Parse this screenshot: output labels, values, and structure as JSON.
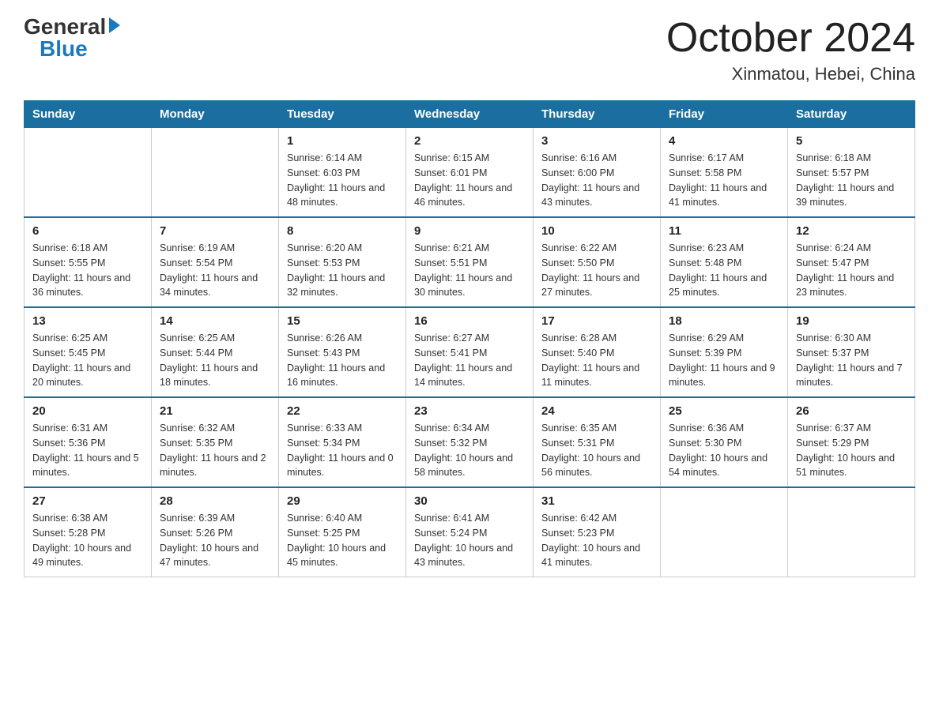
{
  "logo": {
    "general": "General",
    "blue": "Blue",
    "triangle": "▶"
  },
  "title": "October 2024",
  "location": "Xinmatou, Hebei, China",
  "headers": [
    "Sunday",
    "Monday",
    "Tuesday",
    "Wednesday",
    "Thursday",
    "Friday",
    "Saturday"
  ],
  "weeks": [
    [
      {
        "day": "",
        "sunrise": "",
        "sunset": "",
        "daylight": ""
      },
      {
        "day": "",
        "sunrise": "",
        "sunset": "",
        "daylight": ""
      },
      {
        "day": "1",
        "sunrise": "Sunrise: 6:14 AM",
        "sunset": "Sunset: 6:03 PM",
        "daylight": "Daylight: 11 hours and 48 minutes."
      },
      {
        "day": "2",
        "sunrise": "Sunrise: 6:15 AM",
        "sunset": "Sunset: 6:01 PM",
        "daylight": "Daylight: 11 hours and 46 minutes."
      },
      {
        "day": "3",
        "sunrise": "Sunrise: 6:16 AM",
        "sunset": "Sunset: 6:00 PM",
        "daylight": "Daylight: 11 hours and 43 minutes."
      },
      {
        "day": "4",
        "sunrise": "Sunrise: 6:17 AM",
        "sunset": "Sunset: 5:58 PM",
        "daylight": "Daylight: 11 hours and 41 minutes."
      },
      {
        "day": "5",
        "sunrise": "Sunrise: 6:18 AM",
        "sunset": "Sunset: 5:57 PM",
        "daylight": "Daylight: 11 hours and 39 minutes."
      }
    ],
    [
      {
        "day": "6",
        "sunrise": "Sunrise: 6:18 AM",
        "sunset": "Sunset: 5:55 PM",
        "daylight": "Daylight: 11 hours and 36 minutes."
      },
      {
        "day": "7",
        "sunrise": "Sunrise: 6:19 AM",
        "sunset": "Sunset: 5:54 PM",
        "daylight": "Daylight: 11 hours and 34 minutes."
      },
      {
        "day": "8",
        "sunrise": "Sunrise: 6:20 AM",
        "sunset": "Sunset: 5:53 PM",
        "daylight": "Daylight: 11 hours and 32 minutes."
      },
      {
        "day": "9",
        "sunrise": "Sunrise: 6:21 AM",
        "sunset": "Sunset: 5:51 PM",
        "daylight": "Daylight: 11 hours and 30 minutes."
      },
      {
        "day": "10",
        "sunrise": "Sunrise: 6:22 AM",
        "sunset": "Sunset: 5:50 PM",
        "daylight": "Daylight: 11 hours and 27 minutes."
      },
      {
        "day": "11",
        "sunrise": "Sunrise: 6:23 AM",
        "sunset": "Sunset: 5:48 PM",
        "daylight": "Daylight: 11 hours and 25 minutes."
      },
      {
        "day": "12",
        "sunrise": "Sunrise: 6:24 AM",
        "sunset": "Sunset: 5:47 PM",
        "daylight": "Daylight: 11 hours and 23 minutes."
      }
    ],
    [
      {
        "day": "13",
        "sunrise": "Sunrise: 6:25 AM",
        "sunset": "Sunset: 5:45 PM",
        "daylight": "Daylight: 11 hours and 20 minutes."
      },
      {
        "day": "14",
        "sunrise": "Sunrise: 6:25 AM",
        "sunset": "Sunset: 5:44 PM",
        "daylight": "Daylight: 11 hours and 18 minutes."
      },
      {
        "day": "15",
        "sunrise": "Sunrise: 6:26 AM",
        "sunset": "Sunset: 5:43 PM",
        "daylight": "Daylight: 11 hours and 16 minutes."
      },
      {
        "day": "16",
        "sunrise": "Sunrise: 6:27 AM",
        "sunset": "Sunset: 5:41 PM",
        "daylight": "Daylight: 11 hours and 14 minutes."
      },
      {
        "day": "17",
        "sunrise": "Sunrise: 6:28 AM",
        "sunset": "Sunset: 5:40 PM",
        "daylight": "Daylight: 11 hours and 11 minutes."
      },
      {
        "day": "18",
        "sunrise": "Sunrise: 6:29 AM",
        "sunset": "Sunset: 5:39 PM",
        "daylight": "Daylight: 11 hours and 9 minutes."
      },
      {
        "day": "19",
        "sunrise": "Sunrise: 6:30 AM",
        "sunset": "Sunset: 5:37 PM",
        "daylight": "Daylight: 11 hours and 7 minutes."
      }
    ],
    [
      {
        "day": "20",
        "sunrise": "Sunrise: 6:31 AM",
        "sunset": "Sunset: 5:36 PM",
        "daylight": "Daylight: 11 hours and 5 minutes."
      },
      {
        "day": "21",
        "sunrise": "Sunrise: 6:32 AM",
        "sunset": "Sunset: 5:35 PM",
        "daylight": "Daylight: 11 hours and 2 minutes."
      },
      {
        "day": "22",
        "sunrise": "Sunrise: 6:33 AM",
        "sunset": "Sunset: 5:34 PM",
        "daylight": "Daylight: 11 hours and 0 minutes."
      },
      {
        "day": "23",
        "sunrise": "Sunrise: 6:34 AM",
        "sunset": "Sunset: 5:32 PM",
        "daylight": "Daylight: 10 hours and 58 minutes."
      },
      {
        "day": "24",
        "sunrise": "Sunrise: 6:35 AM",
        "sunset": "Sunset: 5:31 PM",
        "daylight": "Daylight: 10 hours and 56 minutes."
      },
      {
        "day": "25",
        "sunrise": "Sunrise: 6:36 AM",
        "sunset": "Sunset: 5:30 PM",
        "daylight": "Daylight: 10 hours and 54 minutes."
      },
      {
        "day": "26",
        "sunrise": "Sunrise: 6:37 AM",
        "sunset": "Sunset: 5:29 PM",
        "daylight": "Daylight: 10 hours and 51 minutes."
      }
    ],
    [
      {
        "day": "27",
        "sunrise": "Sunrise: 6:38 AM",
        "sunset": "Sunset: 5:28 PM",
        "daylight": "Daylight: 10 hours and 49 minutes."
      },
      {
        "day": "28",
        "sunrise": "Sunrise: 6:39 AM",
        "sunset": "Sunset: 5:26 PM",
        "daylight": "Daylight: 10 hours and 47 minutes."
      },
      {
        "day": "29",
        "sunrise": "Sunrise: 6:40 AM",
        "sunset": "Sunset: 5:25 PM",
        "daylight": "Daylight: 10 hours and 45 minutes."
      },
      {
        "day": "30",
        "sunrise": "Sunrise: 6:41 AM",
        "sunset": "Sunset: 5:24 PM",
        "daylight": "Daylight: 10 hours and 43 minutes."
      },
      {
        "day": "31",
        "sunrise": "Sunrise: 6:42 AM",
        "sunset": "Sunset: 5:23 PM",
        "daylight": "Daylight: 10 hours and 41 minutes."
      },
      {
        "day": "",
        "sunrise": "",
        "sunset": "",
        "daylight": ""
      },
      {
        "day": "",
        "sunrise": "",
        "sunset": "",
        "daylight": ""
      }
    ]
  ]
}
